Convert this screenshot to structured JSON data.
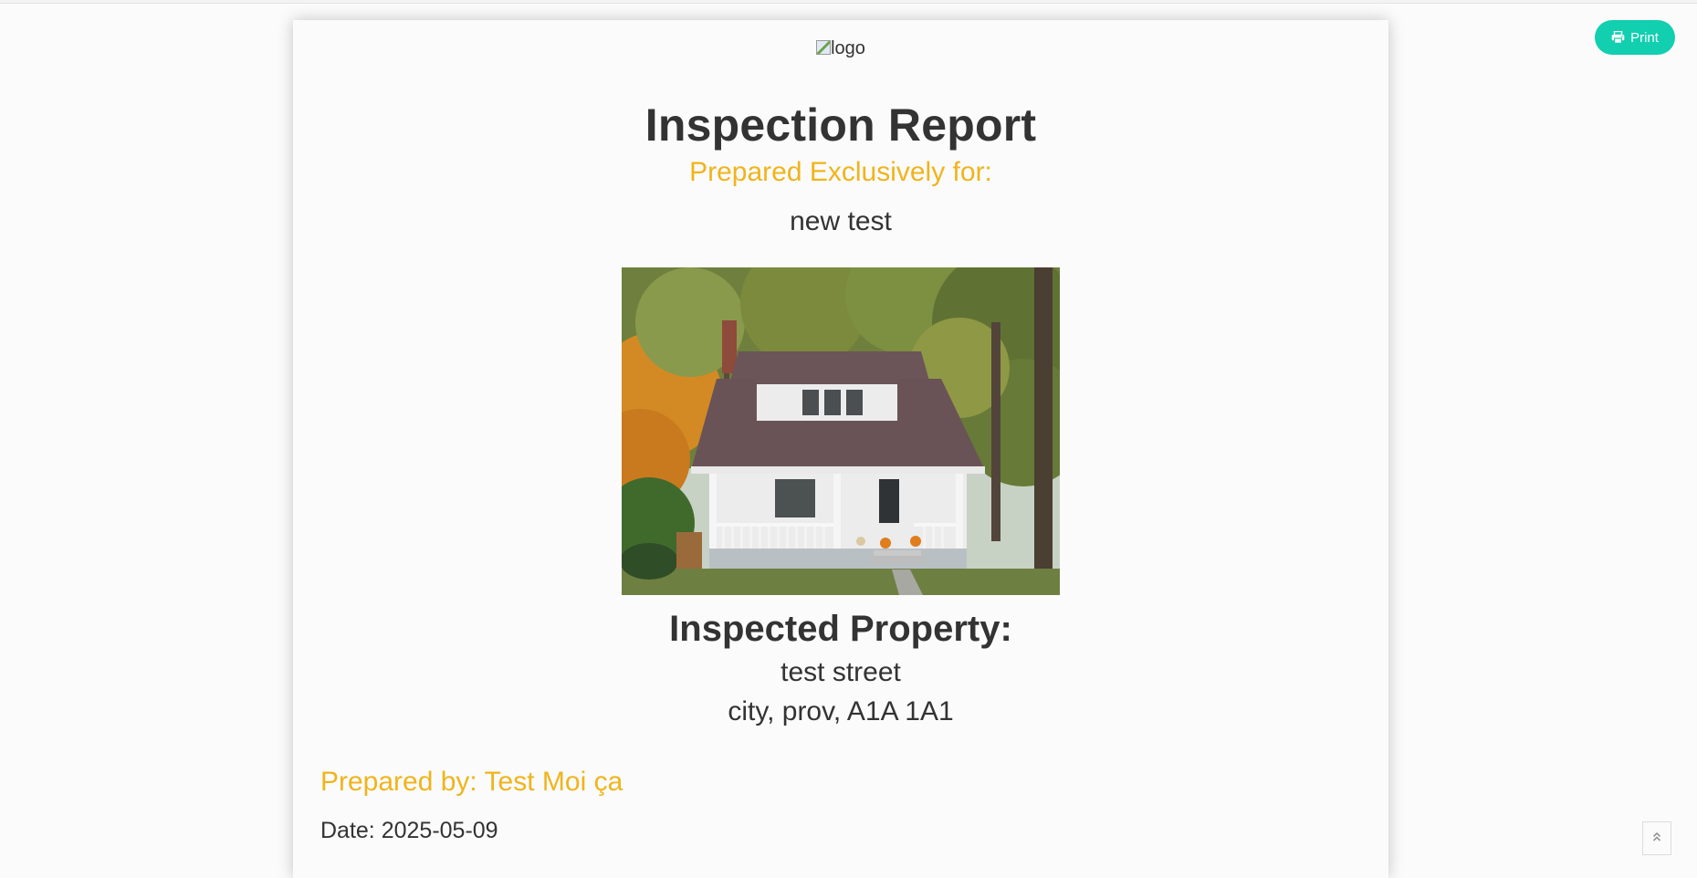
{
  "toolbar": {
    "print_label": "Print",
    "print_icon": "printer-icon",
    "scroll_top_icon": "double-chevron-up-icon"
  },
  "report": {
    "logo_alt": "logo",
    "title": "Inspection Report",
    "prepared_for_label": "Prepared Exclusively for:",
    "client_name": "new test",
    "property_heading": "Inspected Property:",
    "address_line1": "test street",
    "address_line2": "city, prov, A1A 1A1",
    "prepared_by": "Prepared by: Test Moi ça",
    "date": "Date: 2025-05-09"
  },
  "colors": {
    "accent_gold": "#f0b41c",
    "print_button": "#12cfb0",
    "text": "#333333"
  }
}
